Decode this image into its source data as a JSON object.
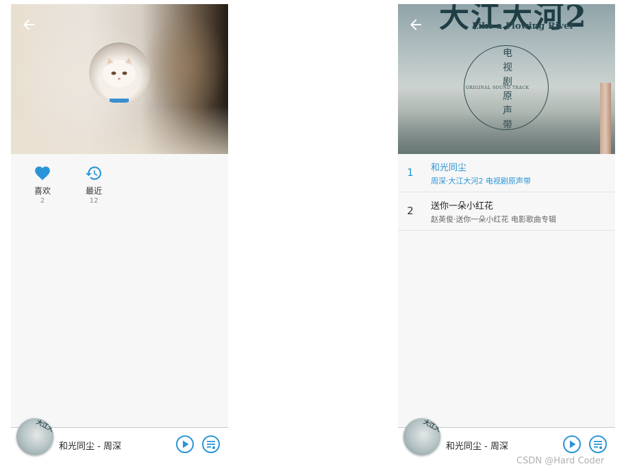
{
  "colors": {
    "accent": "#2a95d6",
    "background": "#f7f7f7",
    "text": "#222222"
  },
  "profile_screen": {
    "back_icon": "arrow-left-icon",
    "stats": [
      {
        "icon": "heart-icon",
        "label": "喜欢",
        "count": "2"
      },
      {
        "icon": "history-icon",
        "label": "最近",
        "count": "12"
      }
    ]
  },
  "album_screen": {
    "back_icon": "arrow-left-icon",
    "cover": {
      "title": "大江大河2",
      "subtitle": "Like a Flowing River",
      "vertical_text": "电视剧原声带",
      "ost": "ORIGINAL SOUND TRACK"
    },
    "tracks": [
      {
        "num": "1",
        "title": "和光同尘",
        "subtitle": "周深·大江大河2 电视剧原声带",
        "active": true
      },
      {
        "num": "2",
        "title": "送你一朵小红花",
        "subtitle": "赵英俊·送你一朵小红花 电影歌曲专辑",
        "active": false
      }
    ]
  },
  "player": {
    "now_playing": "和光同尘 - 周深",
    "cover_text": "大江大河",
    "play_icon": "play-circle-icon",
    "playlist_icon": "playlist-icon"
  },
  "watermark": "CSDN @Hard Coder"
}
